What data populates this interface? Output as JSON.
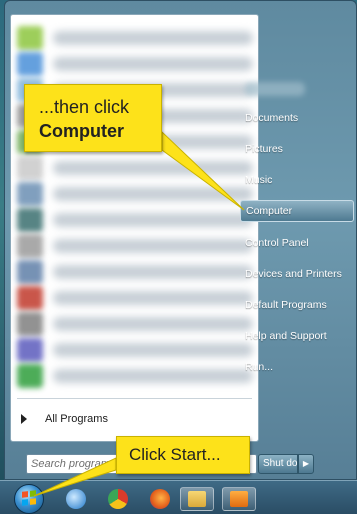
{
  "left_pane": {
    "program_colors": [
      "#8dc63f",
      "#4a90d9",
      "#7fb2d9",
      "#8a8a8a",
      "#6aa84f",
      "#c9c9c9",
      "#6b8fb3",
      "#3a6f6f",
      "#9b9b9b",
      "#5f7fa8",
      "#c0392b",
      "#7f7f7f",
      "#5b5bbd",
      "#2e9e3c"
    ],
    "all_programs": "All Programs",
    "search_placeholder": "Search programs"
  },
  "right_pane": {
    "items": [
      "Documents",
      "Pictures",
      "Music",
      "Computer",
      "Control Panel",
      "Devices and Printers",
      "Default Programs",
      "Help and Support",
      "Run..."
    ],
    "selected": "Computer",
    "shutdown_label": "Shut down",
    "shutdown_arrow": "▶"
  },
  "callouts": {
    "top_line1": "...then click",
    "top_line2": "Computer",
    "bottom": "Click Start..."
  },
  "taskbar": {
    "icons": [
      "ie-icon",
      "chrome-icon",
      "firefox-icon",
      "explorer-icon",
      "media-icon"
    ]
  },
  "colors": {
    "callout": "#fde21a",
    "selected_highlight": "#6a92a8"
  }
}
